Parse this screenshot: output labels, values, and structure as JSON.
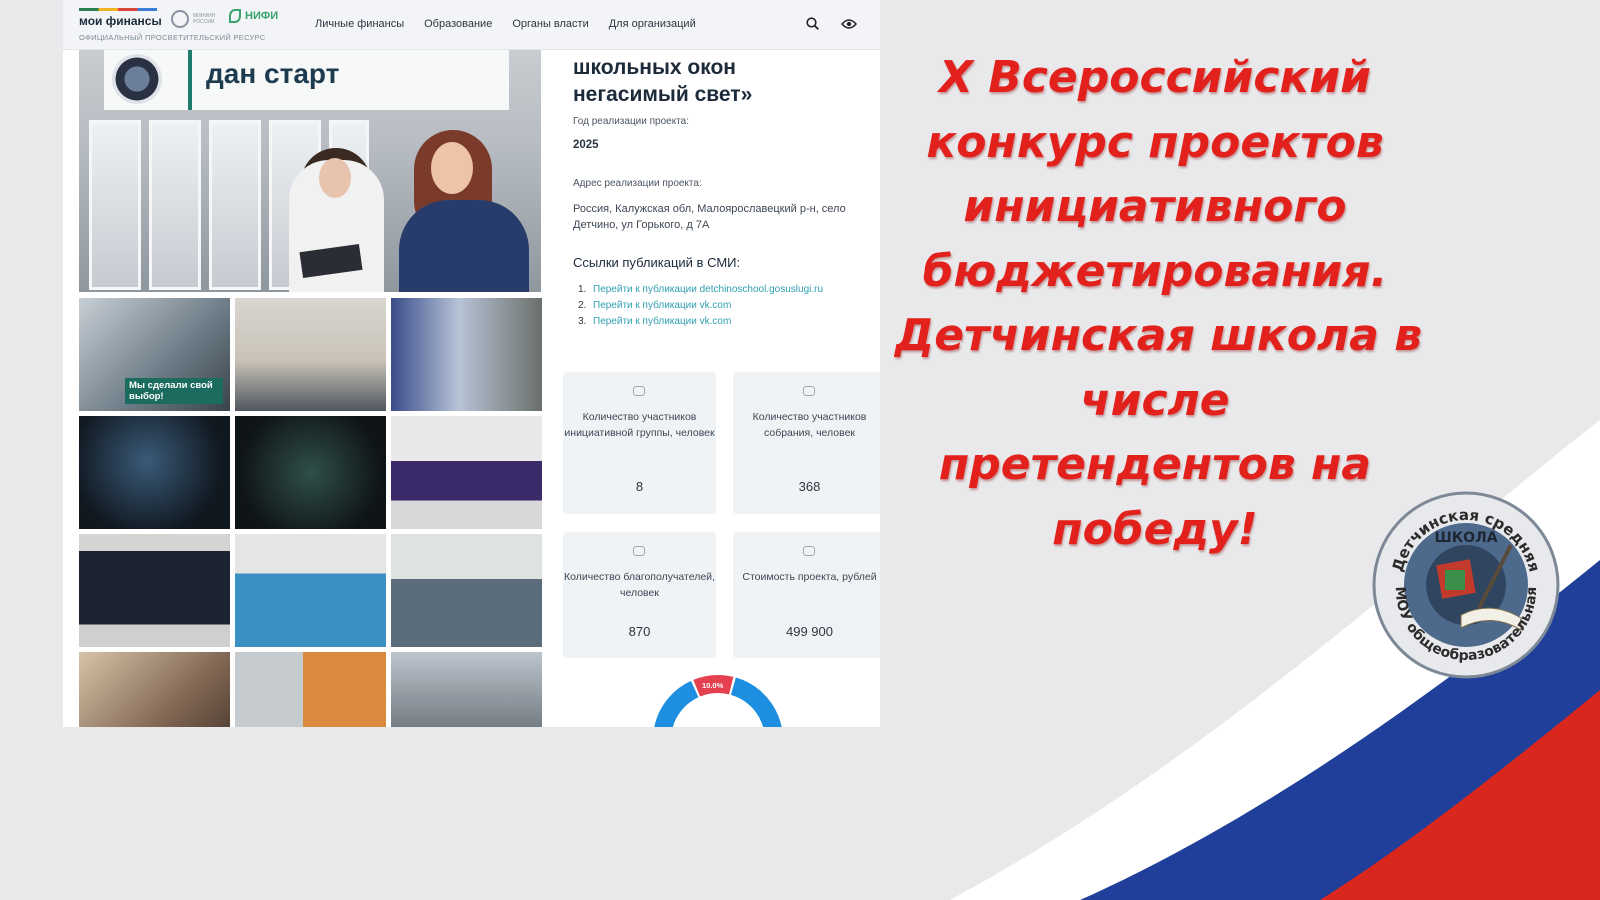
{
  "site": {
    "logo": "мои финансы",
    "tagline": "ОФИЦИАЛЬНЫЙ ПРОСВЕТИТЕЛЬСКИЙ РЕСУРС",
    "partner_minfin": "МИНФИН РОССИИ",
    "partner_nifi": "НИФИ",
    "nav": [
      "Личные финансы",
      "Образование",
      "Органы власти",
      "Для организаций"
    ]
  },
  "hero": {
    "banner_text": "дан старт"
  },
  "thumb_caption": "Мы сделали свой выбор!",
  "project": {
    "title_lines": [
      "школьных окон",
      "негасимый свет»"
    ],
    "year_label": "Год реализации проекта:",
    "year": "2025",
    "address_label": "Адрес реализации проекта:",
    "address": "Россия, Калужская обл, Малоярославецкий р-н, село Детчино, ул Горького, д 7А",
    "media_label": "Ссылки публикаций в СМИ:",
    "media_links": [
      {
        "num": "1.",
        "text": "Перейти к публикации detchinoschool.gosuslugi.ru"
      },
      {
        "num": "2.",
        "text": "Перейти к публикации vk.com"
      },
      {
        "num": "3.",
        "text": "Перейти к публикации vk.com"
      }
    ],
    "stats": [
      {
        "label": "Количество участников инициативной группы, человек",
        "value": "8"
      },
      {
        "label": "Количество участников собрания, человек",
        "value": "368"
      },
      {
        "label": "Количество благополучателей, человек",
        "value": "870"
      },
      {
        "label": "Стоимость проекта, рублей",
        "value": "499 900"
      }
    ],
    "donut_percent_label": "10.0%",
    "donut_fraction": 0.1
  },
  "headline": {
    "lines": [
      "X Всероссийский",
      "конкурс проектов",
      "инициативного",
      "бюджетирования.",
      "Детчинская школа в",
      "числе",
      "претендентов на",
      "победу!"
    ]
  },
  "emblem": {
    "text_top": "Детчинская средняя",
    "text_center": "ШКОЛА",
    "text_bottom": "МОУ общеобразовательная"
  },
  "colors": {
    "headline": "#e2211c",
    "link": "#2f9fb0",
    "flag_blue": "#1f3f9a",
    "flag_red": "#d9271d",
    "donut_blue": "#1e8fe0",
    "donut_red": "#e5404f"
  }
}
